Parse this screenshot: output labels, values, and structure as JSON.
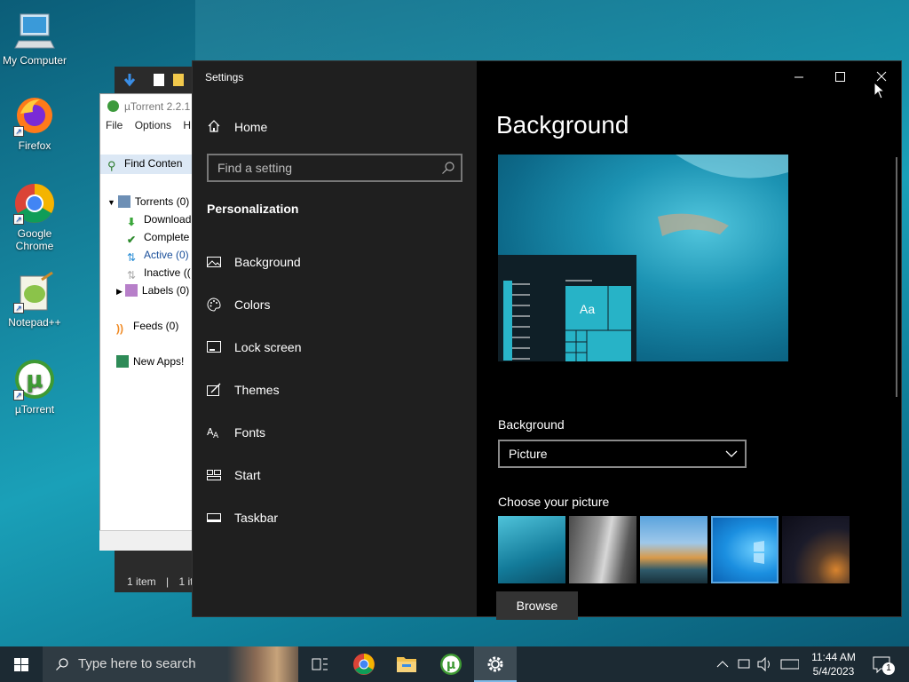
{
  "desktop": {
    "icons": [
      {
        "label": "My Computer"
      },
      {
        "label": "Firefox"
      },
      {
        "label": "Google Chrome"
      },
      {
        "label": "Notepad++"
      },
      {
        "label": "µTorrent"
      }
    ]
  },
  "utorrent": {
    "title": "µTorrent 2.2.1",
    "menu": [
      "File",
      "Options",
      "H"
    ],
    "find_content": "Find Conten",
    "tree": [
      {
        "label": "Torrents (0)"
      },
      {
        "label": "Download"
      },
      {
        "label": "Complete"
      },
      {
        "label": "Active (0)"
      },
      {
        "label": "Inactive (("
      },
      {
        "label": "Labels (0)"
      },
      {
        "label": "Feeds (0)"
      },
      {
        "label": "New Apps!"
      }
    ],
    "status": {
      "items": "1 item",
      "sep": "|",
      "items2": "1 it"
    }
  },
  "settings": {
    "window_title": "Settings",
    "home": "Home",
    "search_placeholder": "Find a setting",
    "section": "Personalization",
    "nav": [
      {
        "label": "Background",
        "icon": "picture-icon"
      },
      {
        "label": "Colors",
        "icon": "palette-icon"
      },
      {
        "label": "Lock screen",
        "icon": "lock-screen-icon"
      },
      {
        "label": "Themes",
        "icon": "themes-icon"
      },
      {
        "label": "Fonts",
        "icon": "fonts-icon"
      },
      {
        "label": "Start",
        "icon": "start-icon"
      },
      {
        "label": "Taskbar",
        "icon": "taskbar-icon"
      }
    ],
    "page_title": "Background",
    "preview_tile_text": "Aa",
    "background_label": "Background",
    "background_value": "Picture",
    "choose_label": "Choose your picture",
    "browse": "Browse"
  },
  "taskbar": {
    "search_placeholder": "Type here to search",
    "time": "11:44 AM",
    "date": "5/4/2023",
    "notification_count": "1",
    "accent": "#7fb9e6"
  }
}
